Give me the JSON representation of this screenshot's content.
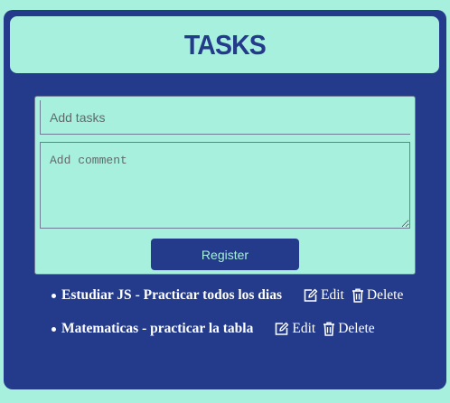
{
  "header": {
    "title": "TASKS"
  },
  "form": {
    "task_placeholder": "Add tasks",
    "comment_placeholder": "Add comment",
    "register_label": "Register"
  },
  "tasks": [
    {
      "title": "Estudiar JS",
      "separator": "-",
      "comment": "Practicar todos los dias",
      "edit_label": "Edit",
      "delete_label": "Delete"
    },
    {
      "title": "Matematicas",
      "separator": "-",
      "comment": "practicar la tabla",
      "edit_label": "Edit",
      "delete_label": "Delete"
    }
  ],
  "colors": {
    "background": "#a8f0de",
    "panel": "#233b8a",
    "text_light": "#ffffff"
  },
  "icons": {
    "edit": "edit-icon",
    "delete": "trash-icon"
  }
}
